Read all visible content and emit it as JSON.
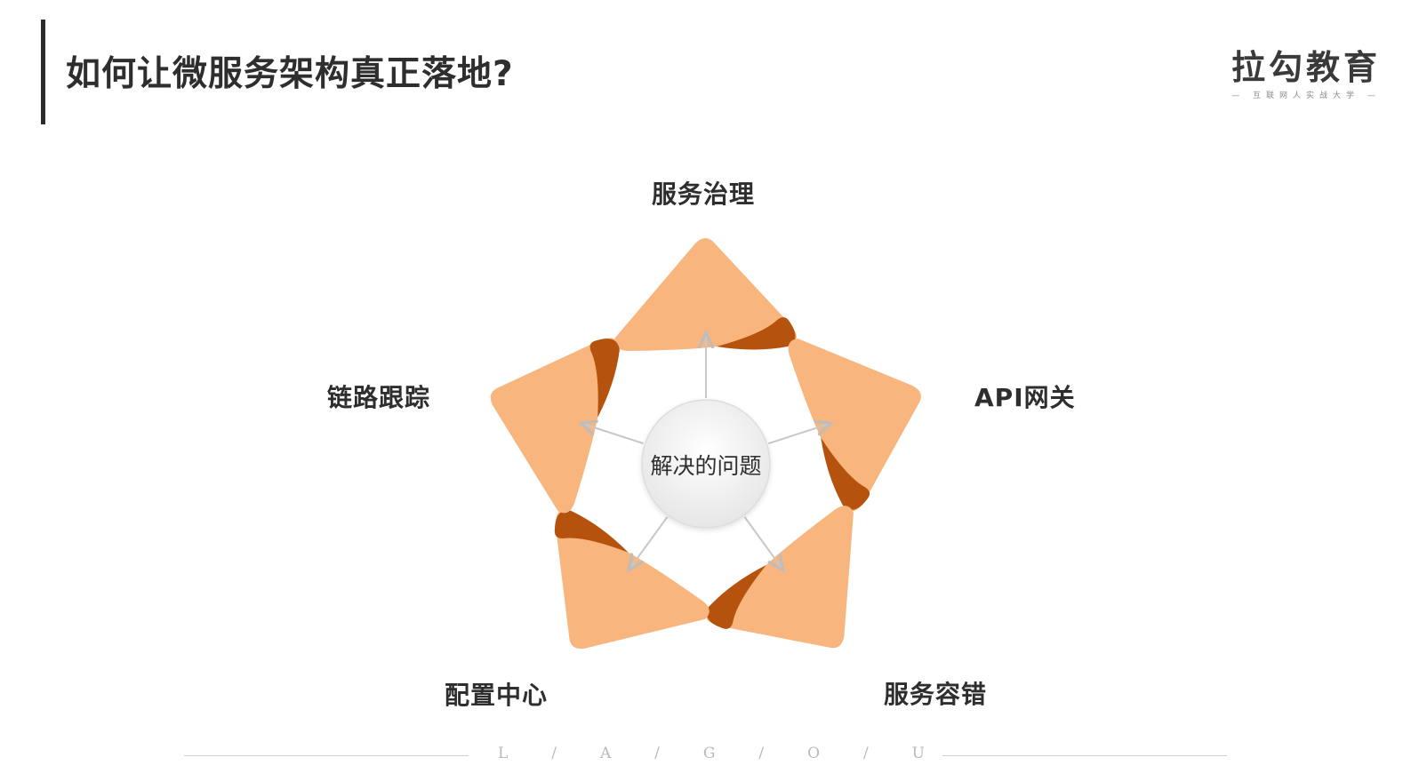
{
  "header": {
    "title": "如何让微服务架构真正落地?",
    "brand_name": "拉勾教育",
    "brand_slogan": "— 互联网人实战大学 —"
  },
  "diagram": {
    "center": "解决的问题",
    "items": [
      {
        "label": "服务治理"
      },
      {
        "label": "API网关"
      },
      {
        "label": "服务容错"
      },
      {
        "label": "配置中心"
      },
      {
        "label": "链路跟踪"
      }
    ],
    "colors": {
      "petal_light": "#f8b57e",
      "petal_dark": "#b5530e",
      "arrow": "#c8c8c8",
      "center_fill": "#f2f2f2"
    }
  },
  "footer": {
    "letters": [
      "L",
      "/",
      "A",
      "/",
      "G",
      "/",
      "O",
      "/",
      "U"
    ]
  }
}
